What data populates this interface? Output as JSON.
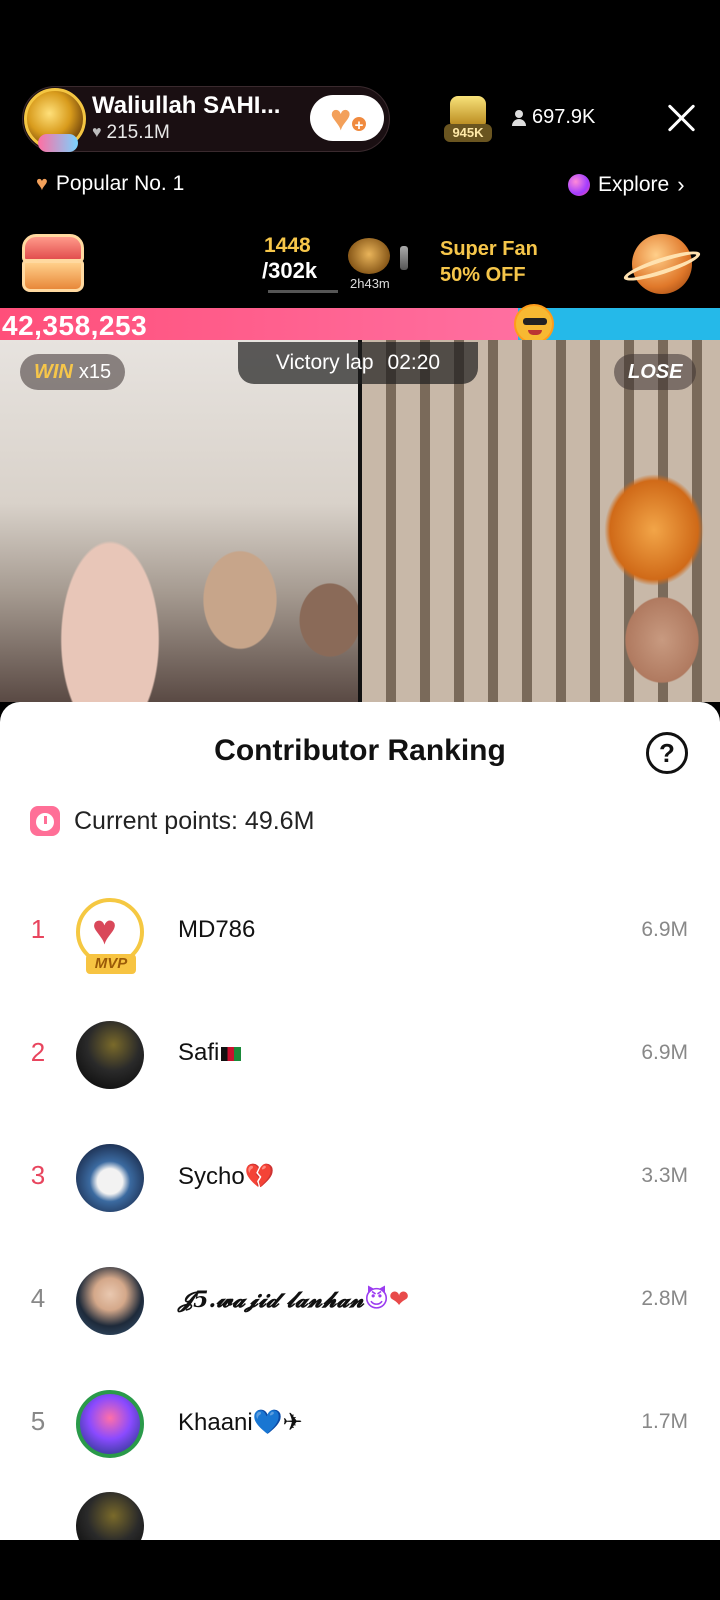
{
  "host": {
    "name": "Waliullah SAHI...",
    "likes": "215.1M",
    "rank_badge": "945K",
    "viewers": "697.9K"
  },
  "nav": {
    "popular": "Popular No. 1",
    "explore": "Explore"
  },
  "promo": {
    "score_current": "1448",
    "score_target": "/302k",
    "timer": "2h43m",
    "superfan_line1": "Super Fan",
    "superfan_line2": "50% OFF"
  },
  "battle": {
    "score": "42,358,253",
    "left_share": 0.72,
    "left_color": "#ff4f7a",
    "right_color": "#25b9e9",
    "win_label": "WIN",
    "win_streak": "x15",
    "phase_label": "Victory lap",
    "phase_time": "02:20",
    "lose_label": "LOSE"
  },
  "sheet": {
    "title": "Contributor Ranking",
    "help": "?",
    "points_label": "Current points: 49.6M"
  },
  "ranking": [
    {
      "rank": "1",
      "name": "MD786",
      "points": "6.9M",
      "badge": "MVP"
    },
    {
      "rank": "2",
      "name": "Safi",
      "points": "6.9M"
    },
    {
      "rank": "3",
      "name": "Sycho",
      "points": "3.3M"
    },
    {
      "rank": "4",
      "name": "𝓙5.𝔀𝓪𝓳𝓲𝓭 𝓵𝓪𝓷𝓱𝓪𝓷",
      "points": "2.8M"
    },
    {
      "rank": "5",
      "name": "Khaani",
      "points": "1.7M"
    }
  ],
  "colors": {
    "rank_top3": "#e8455e",
    "rank_other": "#888888",
    "accent_gold": "#f6c64a"
  }
}
